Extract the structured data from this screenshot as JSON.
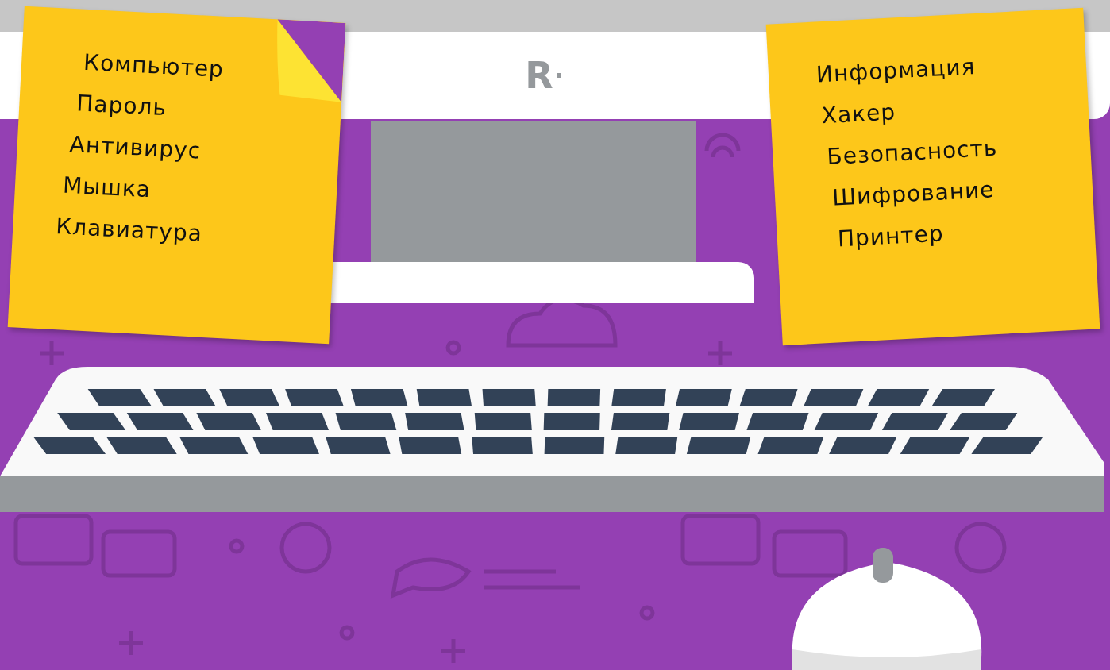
{
  "logo": {
    "text": "R"
  },
  "notes": [
    {
      "folded": true,
      "words": [
        "Компьютер",
        "Пароль",
        "Антивирус",
        "Мышка",
        "Клавиатура"
      ]
    },
    {
      "folded": false,
      "words": [
        "Информация",
        "Хакер",
        "Безопасность",
        "Шифрование",
        "Принтер"
      ]
    }
  ]
}
